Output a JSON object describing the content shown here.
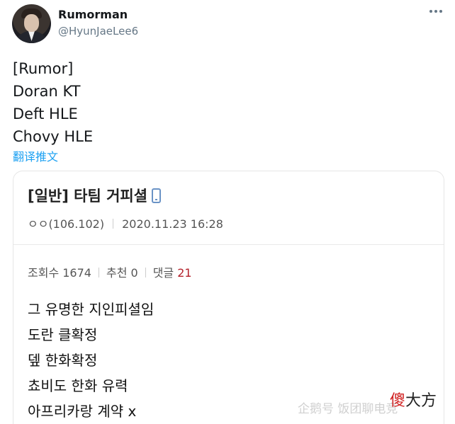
{
  "user": {
    "display_name": "Rumorman",
    "handle": "@HyunJaeLee6"
  },
  "tweet": {
    "lines": [
      "[Rumor]",
      "Doran KT",
      "Deft HLE",
      "Chovy HLE"
    ],
    "translate_label": "翻译推文"
  },
  "card": {
    "title": "[일반] 타팀 거피셜",
    "author": "ㅇㅇ(106.102)",
    "datetime": "2020.11.23 16:28",
    "stats": {
      "views_label": "조회수 1674",
      "recommend_label": "추천 0",
      "comments_label": "댓글",
      "comments_count": "21"
    },
    "body_lines": [
      "그 유명한 지인피셜임",
      "도란 클확정",
      "뎊 한화확정",
      "쵸비도 한화 유력",
      "아프리카랑 계약 x"
    ]
  },
  "watermark": {
    "text": "企鹅号 饭团聊电竞",
    "brand_red": "傻",
    "brand_black": "大方"
  },
  "icons": {
    "more": "more-icon",
    "phone": "mobile-phone-icon"
  }
}
